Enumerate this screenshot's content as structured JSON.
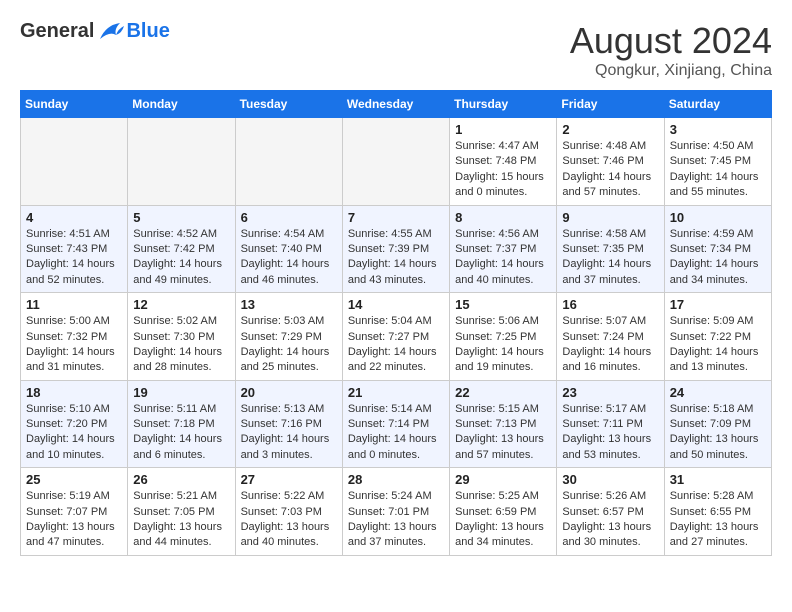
{
  "header": {
    "logo": {
      "line1": "General",
      "line2": "Blue"
    },
    "title": "August 2024",
    "location": "Qongkur, Xinjiang, China"
  },
  "weekdays": [
    "Sunday",
    "Monday",
    "Tuesday",
    "Wednesday",
    "Thursday",
    "Friday",
    "Saturday"
  ],
  "weeks": [
    [
      {
        "day": "",
        "info": ""
      },
      {
        "day": "",
        "info": ""
      },
      {
        "day": "",
        "info": ""
      },
      {
        "day": "",
        "info": ""
      },
      {
        "day": "1",
        "info": "Sunrise: 4:47 AM\nSunset: 7:48 PM\nDaylight: 15 hours\nand 0 minutes."
      },
      {
        "day": "2",
        "info": "Sunrise: 4:48 AM\nSunset: 7:46 PM\nDaylight: 14 hours\nand 57 minutes."
      },
      {
        "day": "3",
        "info": "Sunrise: 4:50 AM\nSunset: 7:45 PM\nDaylight: 14 hours\nand 55 minutes."
      }
    ],
    [
      {
        "day": "4",
        "info": "Sunrise: 4:51 AM\nSunset: 7:43 PM\nDaylight: 14 hours\nand 52 minutes."
      },
      {
        "day": "5",
        "info": "Sunrise: 4:52 AM\nSunset: 7:42 PM\nDaylight: 14 hours\nand 49 minutes."
      },
      {
        "day": "6",
        "info": "Sunrise: 4:54 AM\nSunset: 7:40 PM\nDaylight: 14 hours\nand 46 minutes."
      },
      {
        "day": "7",
        "info": "Sunrise: 4:55 AM\nSunset: 7:39 PM\nDaylight: 14 hours\nand 43 minutes."
      },
      {
        "day": "8",
        "info": "Sunrise: 4:56 AM\nSunset: 7:37 PM\nDaylight: 14 hours\nand 40 minutes."
      },
      {
        "day": "9",
        "info": "Sunrise: 4:58 AM\nSunset: 7:35 PM\nDaylight: 14 hours\nand 37 minutes."
      },
      {
        "day": "10",
        "info": "Sunrise: 4:59 AM\nSunset: 7:34 PM\nDaylight: 14 hours\nand 34 minutes."
      }
    ],
    [
      {
        "day": "11",
        "info": "Sunrise: 5:00 AM\nSunset: 7:32 PM\nDaylight: 14 hours\nand 31 minutes."
      },
      {
        "day": "12",
        "info": "Sunrise: 5:02 AM\nSunset: 7:30 PM\nDaylight: 14 hours\nand 28 minutes."
      },
      {
        "day": "13",
        "info": "Sunrise: 5:03 AM\nSunset: 7:29 PM\nDaylight: 14 hours\nand 25 minutes."
      },
      {
        "day": "14",
        "info": "Sunrise: 5:04 AM\nSunset: 7:27 PM\nDaylight: 14 hours\nand 22 minutes."
      },
      {
        "day": "15",
        "info": "Sunrise: 5:06 AM\nSunset: 7:25 PM\nDaylight: 14 hours\nand 19 minutes."
      },
      {
        "day": "16",
        "info": "Sunrise: 5:07 AM\nSunset: 7:24 PM\nDaylight: 14 hours\nand 16 minutes."
      },
      {
        "day": "17",
        "info": "Sunrise: 5:09 AM\nSunset: 7:22 PM\nDaylight: 14 hours\nand 13 minutes."
      }
    ],
    [
      {
        "day": "18",
        "info": "Sunrise: 5:10 AM\nSunset: 7:20 PM\nDaylight: 14 hours\nand 10 minutes."
      },
      {
        "day": "19",
        "info": "Sunrise: 5:11 AM\nSunset: 7:18 PM\nDaylight: 14 hours\nand 6 minutes."
      },
      {
        "day": "20",
        "info": "Sunrise: 5:13 AM\nSunset: 7:16 PM\nDaylight: 14 hours\nand 3 minutes."
      },
      {
        "day": "21",
        "info": "Sunrise: 5:14 AM\nSunset: 7:14 PM\nDaylight: 14 hours\nand 0 minutes."
      },
      {
        "day": "22",
        "info": "Sunrise: 5:15 AM\nSunset: 7:13 PM\nDaylight: 13 hours\nand 57 minutes."
      },
      {
        "day": "23",
        "info": "Sunrise: 5:17 AM\nSunset: 7:11 PM\nDaylight: 13 hours\nand 53 minutes."
      },
      {
        "day": "24",
        "info": "Sunrise: 5:18 AM\nSunset: 7:09 PM\nDaylight: 13 hours\nand 50 minutes."
      }
    ],
    [
      {
        "day": "25",
        "info": "Sunrise: 5:19 AM\nSunset: 7:07 PM\nDaylight: 13 hours\nand 47 minutes."
      },
      {
        "day": "26",
        "info": "Sunrise: 5:21 AM\nSunset: 7:05 PM\nDaylight: 13 hours\nand 44 minutes."
      },
      {
        "day": "27",
        "info": "Sunrise: 5:22 AM\nSunset: 7:03 PM\nDaylight: 13 hours\nand 40 minutes."
      },
      {
        "day": "28",
        "info": "Sunrise: 5:24 AM\nSunset: 7:01 PM\nDaylight: 13 hours\nand 37 minutes."
      },
      {
        "day": "29",
        "info": "Sunrise: 5:25 AM\nSunset: 6:59 PM\nDaylight: 13 hours\nand 34 minutes."
      },
      {
        "day": "30",
        "info": "Sunrise: 5:26 AM\nSunset: 6:57 PM\nDaylight: 13 hours\nand 30 minutes."
      },
      {
        "day": "31",
        "info": "Sunrise: 5:28 AM\nSunset: 6:55 PM\nDaylight: 13 hours\nand 27 minutes."
      }
    ]
  ]
}
